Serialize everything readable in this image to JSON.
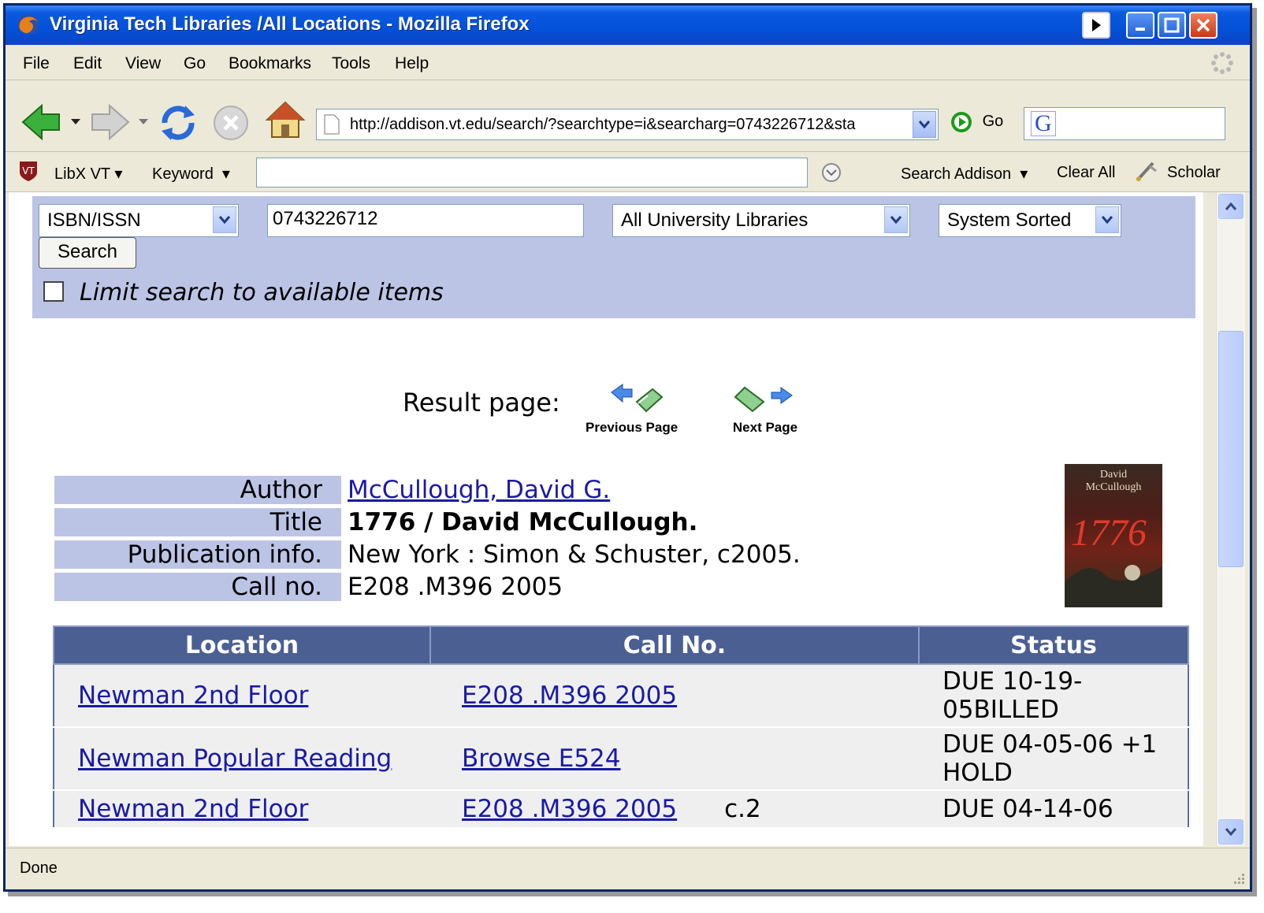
{
  "window": {
    "title": "Virginia Tech Libraries /All Locations - Mozilla Firefox"
  },
  "menu": {
    "items": [
      "File",
      "Edit",
      "View",
      "Go",
      "Bookmarks",
      "Tools",
      "Help"
    ]
  },
  "navbar": {
    "url": "http://addison.vt.edu/search/?searchtype=i&searcharg=0743226712&sta",
    "go_label": "Go",
    "search_engine_value": "G"
  },
  "libx": {
    "brand": "LibX VT",
    "search_type": "Keyword",
    "input_value": "",
    "search_addison": "Search Addison",
    "clear_all": "Clear All",
    "scholar": "Scholar"
  },
  "search": {
    "field_type": "ISBN/ISSN",
    "query": "0743226712",
    "scope": "All University Libraries",
    "sort": "System Sorted",
    "button": "Search",
    "limit_label": "Limit search to available items"
  },
  "pager": {
    "label": "Result page:",
    "prev": "Previous Page",
    "next": "Next Page"
  },
  "record": {
    "labels": {
      "author": "Author",
      "title": "Title",
      "pub": "Publication info.",
      "callno": "Call no."
    },
    "author": "McCullough, David G.",
    "title": "1776 / David McCullough.",
    "pub": "New York : Simon & Schuster, c2005.",
    "callno": "E208 .M396 2005",
    "cover": {
      "author_line1": "David",
      "author_line2": "McCullough",
      "title": "1776"
    }
  },
  "holdings": {
    "headers": [
      "Location",
      "Call No.",
      "Status"
    ],
    "rows": [
      {
        "location": "Newman 2nd Floor",
        "call": "E208 .M396 2005",
        "copy": "",
        "status": "DUE 10-19-05BILLED"
      },
      {
        "location": "Newman Popular Reading",
        "call": "Browse E524",
        "copy": "",
        "status": "DUE 04-05-06 +1 HOLD"
      },
      {
        "location": "Newman 2nd Floor",
        "call": "E208 .M396 2005",
        "copy": "c.2",
        "status": "DUE 04-14-06"
      }
    ]
  },
  "statusbar": {
    "text": "Done"
  },
  "colors": {
    "panel": "#bcc4e6",
    "table_header": "#4b5f93",
    "link": "#1a1aa6"
  }
}
